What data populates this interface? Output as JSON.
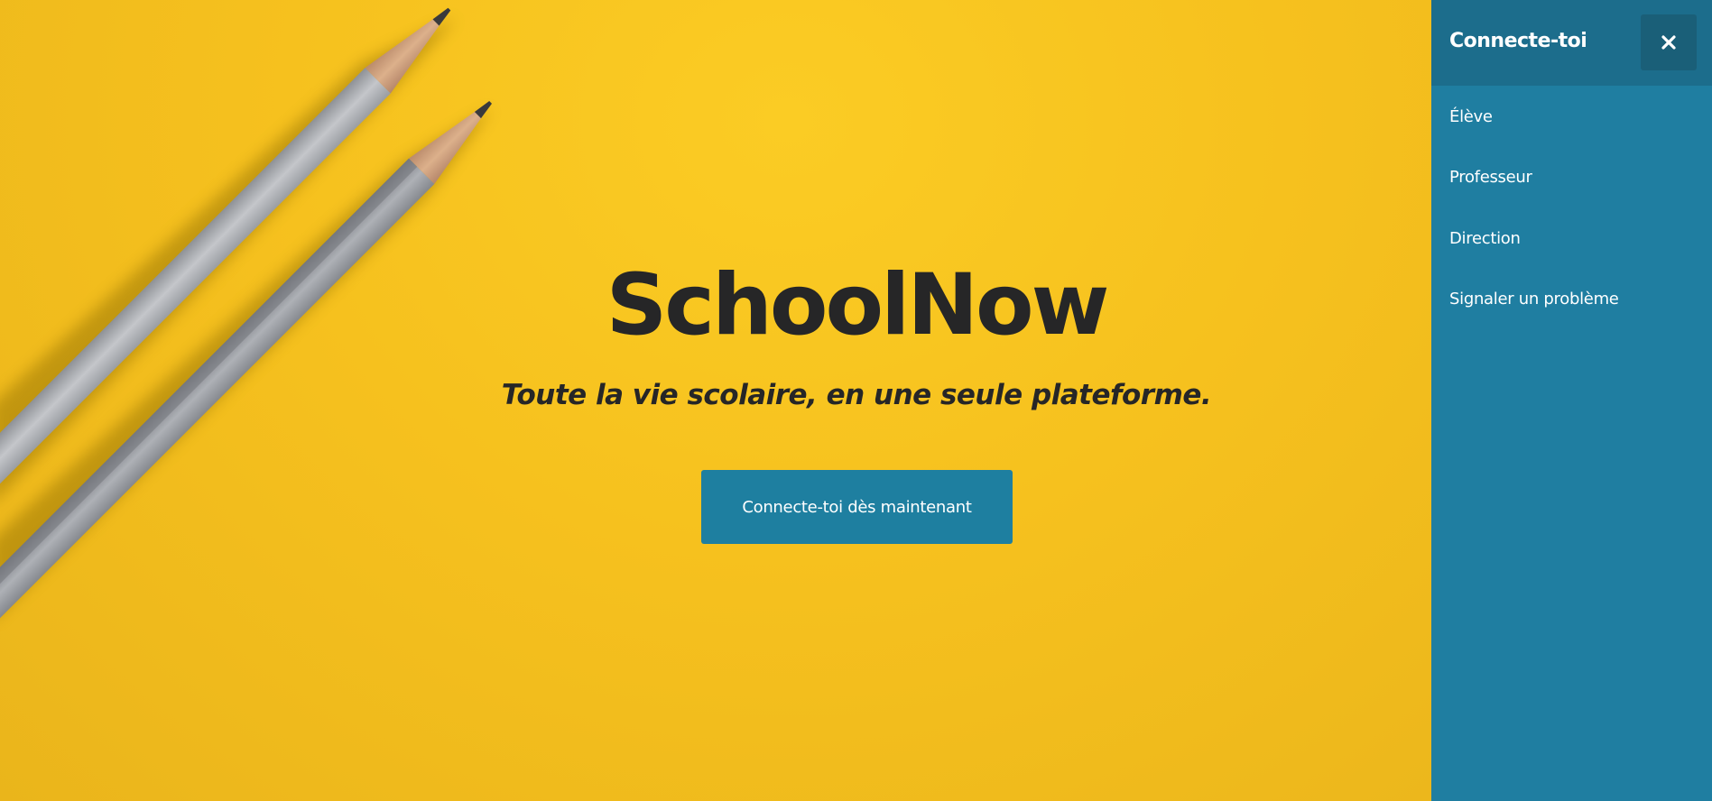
{
  "hero": {
    "title": "SchoolNow",
    "tagline": "Toute la vie scolaire, en une seule plateforme.",
    "cta_label": "Connecte-toi dès maintenant"
  },
  "sidebar": {
    "title": "Connecte-toi",
    "close_icon": "close-icon",
    "items": [
      {
        "label": "Élève"
      },
      {
        "label": "Professeur"
      },
      {
        "label": "Direction"
      },
      {
        "label": "Signaler un problème"
      }
    ]
  },
  "colors": {
    "hero_background": "#f6c11e",
    "text_dark": "#262627",
    "accent": "#1f7ea1",
    "sidebar_header": "#1c6d8c",
    "close_button": "#1a5f78"
  }
}
